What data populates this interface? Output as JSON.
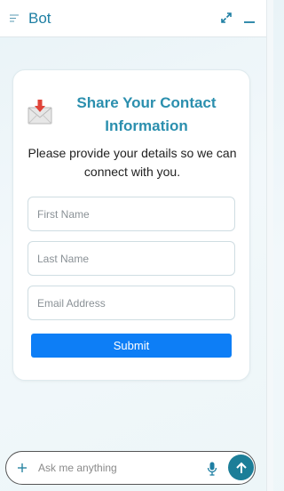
{
  "header": {
    "title": "Bot",
    "icons": {
      "menu": "menu-lines-icon",
      "expand": "expand-arrows-icon",
      "minimize": "minimize-icon"
    }
  },
  "card": {
    "icon": "envelope-download-icon",
    "title": "Share Your Contact Information",
    "subtitle": "Please provide your details so we can connect with you.",
    "fields": {
      "first_name_placeholder": "First Name",
      "last_name_placeholder": "Last Name",
      "email_placeholder": "Email Address"
    },
    "submit_label": "Submit"
  },
  "composer": {
    "placeholder": "Ask me anything",
    "icons": {
      "add": "plus-icon",
      "mic": "microphone-icon",
      "send": "arrow-up-icon"
    }
  },
  "colors": {
    "accent": "#1e7fa3",
    "title": "#2b8fae",
    "submit": "#0d7ef6",
    "send": "#1c7e98"
  }
}
